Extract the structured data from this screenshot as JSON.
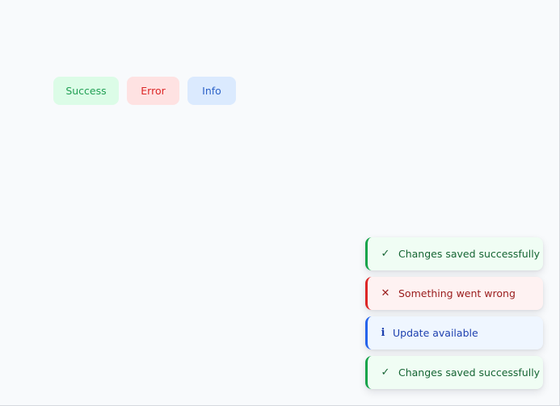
{
  "triggers": {
    "success_label": "Success",
    "error_label": "Error",
    "info_label": "Info"
  },
  "toasts": [
    {
      "type": "success",
      "icon": "check-icon",
      "glyph": "✓",
      "message": "Changes saved successfully"
    },
    {
      "type": "error",
      "icon": "close-icon",
      "glyph": "✕",
      "message": "Something went wrong"
    },
    {
      "type": "info",
      "icon": "info-icon",
      "glyph": "i",
      "message": "Update available"
    },
    {
      "type": "success",
      "icon": "check-icon",
      "glyph": "✓",
      "message": "Changes saved successfully"
    }
  ],
  "colors": {
    "success": "#16a34a",
    "error": "#dc2626",
    "info": "#2563eb",
    "page_background": "#f8fafc"
  }
}
